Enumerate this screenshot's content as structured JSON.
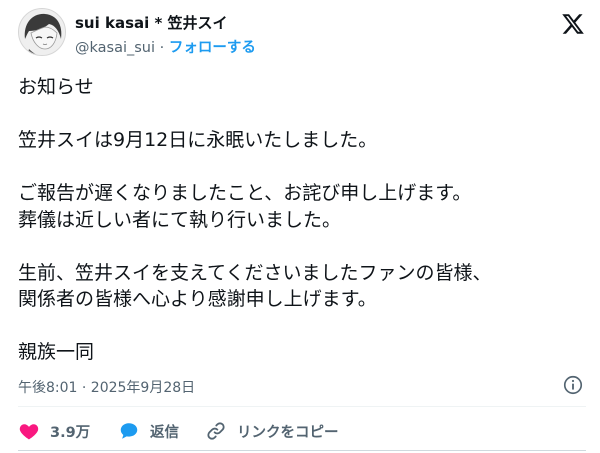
{
  "author": {
    "display_name": "sui kasai * 笠井スイ",
    "handle": "@kasai_sui",
    "separator": "·",
    "follow_label": "フォローする"
  },
  "icons": {
    "avatar": "avatar-illustration",
    "brand": "x-logo-icon",
    "info": "info-icon",
    "like": "heart-icon",
    "reply": "speech-bubble-icon",
    "copy": "link-icon"
  },
  "tweet": {
    "lines": [
      "お知らせ",
      "",
      "笠井スイは9月12日に永眠いたしました。",
      "",
      "ご報告が遅くなりましたこと、お詫び申し上げます。",
      "葬儀は近しい者にて執り行いました。",
      "",
      "生前、笠井スイを支えてくださいましたファンの皆様、",
      "関係者の皆様へ心より感謝申し上げます。",
      "",
      "親族一同"
    ]
  },
  "meta": {
    "timestamp": "午後8:01 · 2025年9月28日"
  },
  "actions": {
    "like_count": "3.9万",
    "reply_label": "返信",
    "copy_link_label": "リンクをコピー"
  },
  "colors": {
    "like": "#f91880",
    "reply": "#1d9bf0",
    "follow": "#1d9bf0",
    "muted": "#536471",
    "text": "#0f1419"
  }
}
